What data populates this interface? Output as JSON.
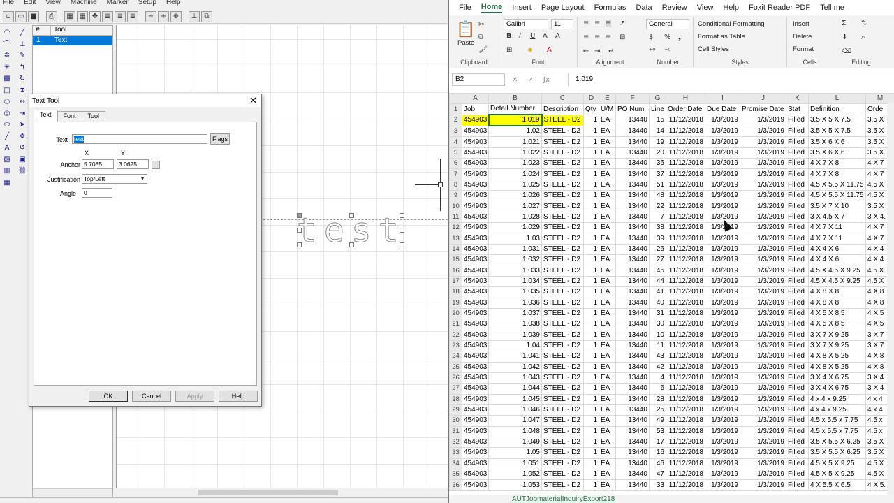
{
  "cad": {
    "menu": [
      "File",
      "Edit",
      "View",
      "Machine",
      "Marker",
      "Setup",
      "Help"
    ],
    "toolbar_icons": [
      "new-icon",
      "open-icon",
      "save-icon",
      "print-icon",
      "grid-icon",
      "grid2-icon",
      "align-icon",
      "align2-icon",
      "align3-icon",
      "move-icon",
      "zoom-out-icon",
      "zoom-in-icon",
      "zoom-fit-icon",
      "pin-icon",
      "paste-icon"
    ],
    "tool_table": {
      "col_num": "#",
      "col_tool": "Tool",
      "rows": [
        {
          "num": "1",
          "tool": "Text"
        }
      ]
    },
    "canvas_text": "test"
  },
  "dialog": {
    "title": "Text Tool",
    "tabs": [
      "Text",
      "Font",
      "Tool"
    ],
    "text_label": "Text",
    "text_value": "test",
    "flags_button": "Flags",
    "x_label": "X",
    "y_label": "Y",
    "anchor_label": "Anchor",
    "anchor_x": "5.7085",
    "anchor_y": "3.0625",
    "justification_label": "Justification",
    "justification_value": "Top/Left",
    "angle_label": "Angle",
    "angle_value": "0",
    "ok": "OK",
    "cancel": "Cancel",
    "apply": "Apply",
    "help": "Help"
  },
  "excel": {
    "ribbon_tabs": [
      "File",
      "Home",
      "Insert",
      "Page Layout",
      "Formulas",
      "Data",
      "Review",
      "View",
      "Help",
      "Foxit Reader PDF",
      "Tell me"
    ],
    "active_tab": "Home",
    "clipboard": {
      "paste": "Paste",
      "label": "Clipboard"
    },
    "font": {
      "name": "Calibri",
      "size": "11",
      "label": "Font"
    },
    "alignment": {
      "label": "Alignment"
    },
    "number": {
      "format": "General",
      "label": "Number"
    },
    "styles": {
      "conditional": "Conditional Formatting",
      "format_table": "Format as Table",
      "cell_styles": "Cell Styles",
      "label": "Styles"
    },
    "cells": {
      "insert": "Insert",
      "delete": "Delete",
      "format": "Format",
      "label": "Cells"
    },
    "editing": {
      "label": "Editing"
    },
    "name_box": "B2",
    "formula_value": "1.019",
    "columns": [
      "",
      "A",
      "B",
      "C",
      "D",
      "E",
      "F",
      "G",
      "H",
      "I",
      "J",
      "K",
      "L",
      "M"
    ],
    "header_row": [
      "Job",
      "Detail Number",
      "Description",
      "Qty",
      "U/M",
      "PO Num",
      "Line",
      "Order Date",
      "Due Date",
      "Promise Date",
      "Stat",
      "Definition",
      "Orde"
    ],
    "rows": [
      [
        "454903",
        "1.019",
        "STEEL - D2",
        "1",
        "EA",
        "13440",
        "15",
        "11/12/2018",
        "1/3/2019",
        "1/3/2019",
        "Filled",
        "3.5 X 5 X 7.5",
        "3.5 X"
      ],
      [
        "454903",
        "1.02",
        "STEEL - D2",
        "1",
        "EA",
        "13440",
        "14",
        "11/12/2018",
        "1/3/2019",
        "1/3/2019",
        "Filled",
        "3.5 X 5 X 7.5",
        "3.5 X"
      ],
      [
        "454903",
        "1.021",
        "STEEL - D2",
        "1",
        "EA",
        "13440",
        "19",
        "11/12/2018",
        "1/3/2019",
        "1/3/2019",
        "Filled",
        "3.5 X 6 X 6",
        "3.5 X"
      ],
      [
        "454903",
        "1.022",
        "STEEL - D2",
        "1",
        "EA",
        "13440",
        "20",
        "11/12/2018",
        "1/3/2019",
        "1/3/2019",
        "Filled",
        "3.5 X 6 X 6",
        "3.5 X"
      ],
      [
        "454903",
        "1.023",
        "STEEL - D2",
        "1",
        "EA",
        "13440",
        "36",
        "11/12/2018",
        "1/3/2019",
        "1/3/2019",
        "Filled",
        "4 X 7 X 8",
        "4 X 7"
      ],
      [
        "454903",
        "1.024",
        "STEEL - D2",
        "1",
        "EA",
        "13440",
        "37",
        "11/12/2018",
        "1/3/2019",
        "1/3/2019",
        "Filled",
        "4 X 7 X 8",
        "4 X 7"
      ],
      [
        "454903",
        "1.025",
        "STEEL - D2",
        "1",
        "EA",
        "13440",
        "51",
        "11/12/2018",
        "1/3/2019",
        "1/3/2019",
        "Filled",
        "4.5 X 5.5 X 11.75",
        "4.5 X"
      ],
      [
        "454903",
        "1.026",
        "STEEL - D2",
        "1",
        "EA",
        "13440",
        "48",
        "11/12/2018",
        "1/3/2019",
        "1/3/2019",
        "Filled",
        "4.5 X 5.5 X 11.75",
        "4.5 X"
      ],
      [
        "454903",
        "1.027",
        "STEEL - D2",
        "1",
        "EA",
        "13440",
        "22",
        "11/12/2018",
        "1/3/2019",
        "1/3/2019",
        "Filled",
        "3.5 X 7 X 10",
        "3.5 X"
      ],
      [
        "454903",
        "1.028",
        "STEEL - D2",
        "1",
        "EA",
        "13440",
        "7",
        "11/12/2018",
        "1/3/2019",
        "1/3/2019",
        "Filled",
        "3 X 4.5 X 7",
        "3 X 4."
      ],
      [
        "454903",
        "1.029",
        "STEEL - D2",
        "1",
        "EA",
        "13440",
        "38",
        "11/12/2018",
        "1/3/2019",
        "1/3/2019",
        "Filled",
        "4 X 7 X 11",
        "4 X 7"
      ],
      [
        "454903",
        "1.03",
        "STEEL - D2",
        "1",
        "EA",
        "13440",
        "39",
        "11/12/2018",
        "1/3/2019",
        "1/3/2019",
        "Filled",
        "4 X 7 X 11",
        "4 X 7"
      ],
      [
        "454903",
        "1.031",
        "STEEL - D2",
        "1",
        "EA",
        "13440",
        "26",
        "11/12/2018",
        "1/3/2019",
        "1/3/2019",
        "Filled",
        "4 X 4 X 6",
        "4 X 4"
      ],
      [
        "454903",
        "1.032",
        "STEEL - D2",
        "1",
        "EA",
        "13440",
        "27",
        "11/12/2018",
        "1/3/2019",
        "1/3/2019",
        "Filled",
        "4 X 4 X 6",
        "4 X 4"
      ],
      [
        "454903",
        "1.033",
        "STEEL - D2",
        "1",
        "EA",
        "13440",
        "45",
        "11/12/2018",
        "1/3/2019",
        "1/3/2019",
        "Filled",
        "4.5 X 4.5 X 9.25",
        "4.5 X"
      ],
      [
        "454903",
        "1.034",
        "STEEL - D2",
        "1",
        "EA",
        "13440",
        "44",
        "11/12/2018",
        "1/3/2019",
        "1/3/2019",
        "Filled",
        "4.5 X 4.5 X 9.25",
        "4.5 X"
      ],
      [
        "454903",
        "1.035",
        "STEEL - D2",
        "1",
        "EA",
        "13440",
        "41",
        "11/12/2018",
        "1/3/2019",
        "1/3/2019",
        "Filled",
        "4 X 8 X 8",
        "4 X 8"
      ],
      [
        "454903",
        "1.036",
        "STEEL - D2",
        "1",
        "EA",
        "13440",
        "40",
        "11/12/2018",
        "1/3/2019",
        "1/3/2019",
        "Filled",
        "4 X 8 X 8",
        "4 X 8"
      ],
      [
        "454903",
        "1.037",
        "STEEL - D2",
        "1",
        "EA",
        "13440",
        "31",
        "11/12/2018",
        "1/3/2019",
        "1/3/2019",
        "Filled",
        "4 X 5 X 8.5",
        "4 X 5"
      ],
      [
        "454903",
        "1.038",
        "STEEL - D2",
        "1",
        "EA",
        "13440",
        "30",
        "11/12/2018",
        "1/3/2019",
        "1/3/2019",
        "Filled",
        "4 X 5 X 8.5",
        "4 X 5"
      ],
      [
        "454903",
        "1.039",
        "STEEL - D2",
        "1",
        "EA",
        "13440",
        "10",
        "11/12/2018",
        "1/3/2019",
        "1/3/2019",
        "Filled",
        "3 X 7 X 9.25",
        "3 X 7"
      ],
      [
        "454903",
        "1.04",
        "STEEL - D2",
        "1",
        "EA",
        "13440",
        "11",
        "11/12/2018",
        "1/3/2019",
        "1/3/2019",
        "Filled",
        "3 X 7 X 9.25",
        "3 X 7"
      ],
      [
        "454903",
        "1.041",
        "STEEL - D2",
        "1",
        "EA",
        "13440",
        "43",
        "11/12/2018",
        "1/3/2019",
        "1/3/2019",
        "Filled",
        "4 X 8 X 5.25",
        "4 X 8"
      ],
      [
        "454903",
        "1.042",
        "STEEL - D2",
        "1",
        "EA",
        "13440",
        "42",
        "11/12/2018",
        "1/3/2019",
        "1/3/2019",
        "Filled",
        "4 X 8 X 5.25",
        "4 X 8"
      ],
      [
        "454903",
        "1.043",
        "STEEL - D2",
        "1",
        "EA",
        "13440",
        "4",
        "11/12/2018",
        "1/3/2019",
        "1/3/2019",
        "Filled",
        "3 X 4 X 6.75",
        "3 X 4"
      ],
      [
        "454903",
        "1.044",
        "STEEL - D2",
        "1",
        "EA",
        "13440",
        "6",
        "11/12/2018",
        "1/3/2019",
        "1/3/2019",
        "Filled",
        "3 X 4 X 6.75",
        "3 X 4"
      ],
      [
        "454903",
        "1.045",
        "STEEL - D2",
        "1",
        "EA",
        "13440",
        "28",
        "11/12/2018",
        "1/3/2019",
        "1/3/2019",
        "Filled",
        "4 x 4 x 9.25",
        "4 x 4"
      ],
      [
        "454903",
        "1.046",
        "STEEL - D2",
        "1",
        "EA",
        "13440",
        "25",
        "11/12/2018",
        "1/3/2019",
        "1/3/2019",
        "Filled",
        "4 x 4 x 9.25",
        "4 x 4"
      ],
      [
        "454903",
        "1.047",
        "STEEL - D2",
        "1",
        "EA",
        "13440",
        "49",
        "11/12/2018",
        "1/3/2019",
        "1/3/2019",
        "Filled",
        "4.5 x 5.5 x 7.75",
        "4.5 x"
      ],
      [
        "454903",
        "1.048",
        "STEEL - D2",
        "1",
        "EA",
        "13440",
        "53",
        "11/12/2018",
        "1/3/2019",
        "1/3/2019",
        "Filled",
        "4.5 x 5.5 x 7.75",
        "4.5 x"
      ],
      [
        "454903",
        "1.049",
        "STEEL - D2",
        "1",
        "EA",
        "13440",
        "17",
        "11/12/2018",
        "1/3/2019",
        "1/3/2019",
        "Filled",
        "3.5 X 5.5 X 6.25",
        "3.5 X"
      ],
      [
        "454903",
        "1.05",
        "STEEL - D2",
        "1",
        "EA",
        "13440",
        "16",
        "11/12/2018",
        "1/3/2019",
        "1/3/2019",
        "Filled",
        "3.5 X 5.5 X 6.25",
        "3.5 X"
      ],
      [
        "454903",
        "1.051",
        "STEEL - D2",
        "1",
        "EA",
        "13440",
        "46",
        "11/12/2018",
        "1/3/2019",
        "1/3/2019",
        "Filled",
        "4.5 X 5 X 9.25",
        "4.5 X"
      ],
      [
        "454903",
        "1.052",
        "STEEL - D2",
        "1",
        "EA",
        "13440",
        "47",
        "11/12/2018",
        "1/3/2019",
        "1/3/2019",
        "Filled",
        "4.5 X 5 X 9.25",
        "4.5 X"
      ],
      [
        "454903",
        "1.053",
        "STEEL - D2",
        "1",
        "EA",
        "13440",
        "33",
        "11/12/2018",
        "1/3/2019",
        "1/3/2019",
        "Filled",
        "4 X 5.5 X 6.5",
        "4 X 5."
      ]
    ],
    "sheet_tab": "AUTJobmaterialInquiryExport218",
    "accent_color": "#217346",
    "highlight_color": "#ffff00"
  }
}
